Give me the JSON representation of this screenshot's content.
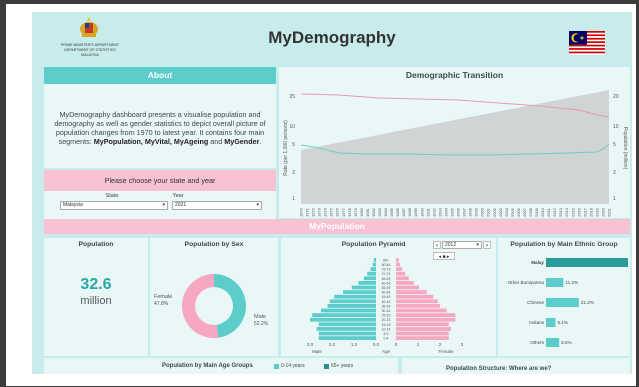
{
  "header": {
    "agency_line1": "PRIME MINISTER'S DEPARTMENT",
    "agency_line2": "DEPARTMENT OF STATISTICS MALAYSIA",
    "title": "MyDemography"
  },
  "about": {
    "heading": "About",
    "intro": "MyDemography dashboard presents a visualise population and demography as well as gender statistics to depict overall picture of population changes from 1970 to latest year.  It contains four main segments: ",
    "segments": "MyPopulation, MyVital, MyAgeing",
    "and": " and ",
    "last_segment": "MyGender",
    "end": "."
  },
  "filters": {
    "heading": "Please choose your state and year",
    "state_label": "State",
    "state_value": "Malaysia",
    "year_label": "Year",
    "year_value": "2021"
  },
  "demographic_transition": {
    "heading": "Demographic Transition",
    "y_left_label": "Rate (per 1,000 persons)",
    "y_right_label": "Population (million)",
    "y_left_ticks": [
      "25",
      "10",
      "5",
      "2",
      "1"
    ],
    "y_right_ticks": [
      "20",
      "10",
      "5",
      "2",
      "1"
    ],
    "x_years": [
      "1970",
      "1971",
      "1972",
      "1973",
      "1974",
      "1975",
      "1976",
      "1977",
      "1978",
      "1979",
      "1980",
      "1981",
      "1982",
      "1983",
      "1984",
      "1985",
      "1986",
      "1987",
      "1988",
      "1989",
      "1990",
      "1991",
      "1992",
      "1993",
      "1994",
      "1995",
      "1996",
      "1997",
      "1998",
      "1999",
      "2000",
      "2001",
      "2002",
      "2003",
      "2004",
      "2005",
      "2006",
      "2007",
      "2008",
      "2009",
      "2010",
      "2011",
      "2012",
      "2013",
      "2014",
      "2015",
      "2016",
      "2017",
      "2018",
      "2019",
      "2020",
      "2021"
    ]
  },
  "my_population": {
    "heading": "MyPopulation",
    "population": {
      "title": "Population",
      "value": "32.6",
      "unit": "million"
    },
    "by_sex": {
      "title": "Population by Sex",
      "female_label": "Female",
      "female_pct": "47.8%",
      "male_label": "Male",
      "male_pct": "52.2%",
      "female_share": 47.8
    },
    "pyramid": {
      "title": "Population Pyramid",
      "year": "2012",
      "age_groups": [
        "85+",
        "80-84",
        "75-79",
        "70-74",
        "65-69",
        "60-64",
        "55-59",
        "50-54",
        "45-49",
        "40-44",
        "35-39",
        "30-34",
        "25-29",
        "20-24",
        "15-19",
        "10-14",
        "5-9",
        "0-4"
      ],
      "male": [
        0.1,
        0.15,
        0.25,
        0.4,
        0.55,
        0.8,
        1.1,
        1.5,
        1.9,
        2.1,
        2.2,
        2.5,
        2.9,
        3.0,
        2.6,
        2.7,
        2.6,
        2.6
      ],
      "female": [
        0.12,
        0.18,
        0.28,
        0.42,
        0.58,
        0.8,
        1.05,
        1.4,
        1.7,
        1.9,
        2.0,
        2.3,
        2.7,
        2.7,
        2.4,
        2.5,
        2.4,
        2.4
      ],
      "male_ticks": [
        "3.0",
        "2.0",
        "1.0",
        "0.0"
      ],
      "female_ticks": [
        "0",
        "1",
        "2",
        "3"
      ],
      "male_label": "Male",
      "age_label": "Age",
      "female_label": "Female"
    },
    "ethnic": {
      "title": "Population by Main Ethnic Group",
      "groups": [
        {
          "name": "Malay",
          "pct": "52.9%",
          "value": 52.9
        },
        {
          "name": "Other Bumiputera",
          "pct": "11.2%",
          "value": 11.2
        },
        {
          "name": "Chinese",
          "pct": "21.2%",
          "value": 21.2
        },
        {
          "name": "Indians",
          "pct": "6.1%",
          "value": 6.1
        },
        {
          "name": "Others",
          "pct": "8.5%",
          "value": 8.5
        }
      ]
    }
  },
  "bottom": {
    "age_groups_title": "Population by Main Age Groups",
    "legend_a": "0-14 years",
    "legend_b": "65+ years",
    "structure_title": "Population Structure: Where are we?"
  },
  "colors": {
    "teal": "#5ccdcb",
    "pink": "#f7c2d1",
    "dark_teal": "#2aa7a5"
  }
}
